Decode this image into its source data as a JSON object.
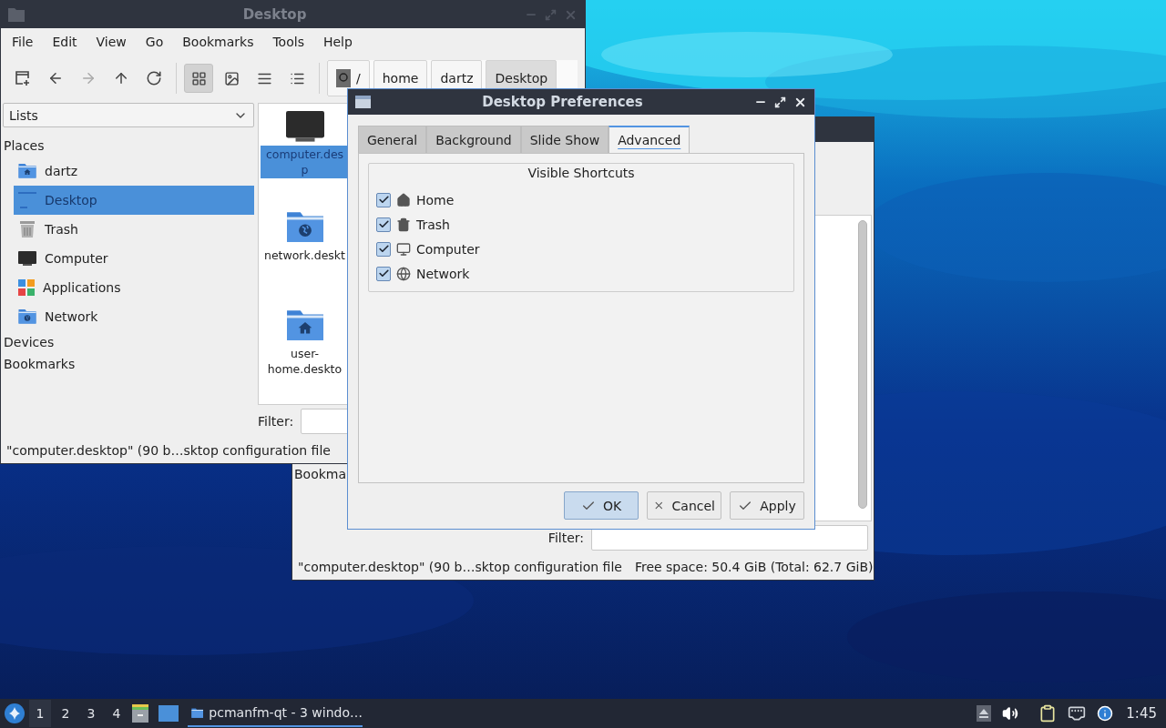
{
  "file_manager": {
    "title": "Desktop",
    "menu": [
      "File",
      "Edit",
      "View",
      "Go",
      "Bookmarks",
      "Tools",
      "Help"
    ],
    "nav": [
      {
        "kind": "new_window",
        "disabled": false
      },
      {
        "kind": "back",
        "disabled": false
      },
      {
        "kind": "forward",
        "disabled": true
      },
      {
        "kind": "up",
        "disabled": false
      },
      {
        "kind": "reload",
        "disabled": false
      }
    ],
    "view_modes": [
      {
        "kind": "icons",
        "selected": true
      },
      {
        "kind": "thumbnails",
        "selected": false
      },
      {
        "kind": "compact",
        "selected": false
      },
      {
        "kind": "detailed",
        "selected": false
      }
    ],
    "path": [
      {
        "label": "/",
        "kind": "root",
        "selected": false
      },
      {
        "label": "home",
        "kind": "dir",
        "selected": false
      },
      {
        "label": "dartz",
        "kind": "dir",
        "selected": false
      },
      {
        "label": "Desktop",
        "kind": "dir",
        "selected": true
      }
    ],
    "sidebar": {
      "combo": "Lists",
      "sections": [
        {
          "title": "Places",
          "items": [
            {
              "label": "dartz",
              "kind": "home",
              "selected": false
            },
            {
              "label": "Desktop",
              "kind": "desktop",
              "selected": true
            },
            {
              "label": "Trash",
              "kind": "trash",
              "selected": false
            },
            {
              "label": "Computer",
              "kind": "computer",
              "selected": false
            },
            {
              "label": "Applications",
              "kind": "applications",
              "selected": false
            },
            {
              "label": "Network",
              "kind": "network",
              "selected": false
            }
          ]
        },
        {
          "title": "Devices"
        },
        {
          "title": "Bookmarks"
        }
      ]
    },
    "files": [
      {
        "lines": [
          "computer.des",
          "p"
        ],
        "kind": "computer",
        "selected": true
      },
      {
        "lines": [
          "network.deskt"
        ],
        "kind": "network",
        "selected": false
      },
      {
        "lines": [
          "user-",
          "home.deskto"
        ],
        "kind": "home",
        "selected": false
      }
    ],
    "filter_label": "Filter:",
    "status": "\"computer.desktop\" (90 b…sktop configuration file"
  },
  "back_window": {
    "sidebar_label": "Bookma",
    "filter_label": "Filter:",
    "status": "\"computer.desktop\" (90 b…sktop configuration file",
    "free_space": "Free space: 50.4 GiB (Total: 62.7 GiB)"
  },
  "dialog": {
    "title": "Desktop Preferences",
    "tabs": [
      {
        "label": "General",
        "selected": false
      },
      {
        "label": "Background",
        "selected": false
      },
      {
        "label": "Slide Show",
        "selected": false
      },
      {
        "label": "Advanced",
        "selected": true
      }
    ],
    "group_title": "Visible Shortcuts",
    "shortcuts": [
      {
        "label": "Home",
        "kind": "home",
        "checked": true
      },
      {
        "label": "Trash",
        "kind": "trash",
        "checked": true
      },
      {
        "label": "Computer",
        "kind": "computer",
        "checked": true
      },
      {
        "label": "Network",
        "kind": "network",
        "checked": true
      }
    ],
    "buttons": [
      {
        "label": "OK",
        "kind": "ok",
        "default": true
      },
      {
        "label": "Cancel",
        "kind": "cancel",
        "default": false
      },
      {
        "label": "Apply",
        "kind": "apply",
        "default": false
      }
    ]
  },
  "taskbar": {
    "desktops": [
      {
        "label": "1",
        "selected": true
      },
      {
        "label": "2",
        "selected": false
      },
      {
        "label": "3",
        "selected": false
      },
      {
        "label": "4",
        "selected": false
      }
    ],
    "task": "pcmanfm-qt - 3 windo…",
    "clock": "1:45"
  }
}
